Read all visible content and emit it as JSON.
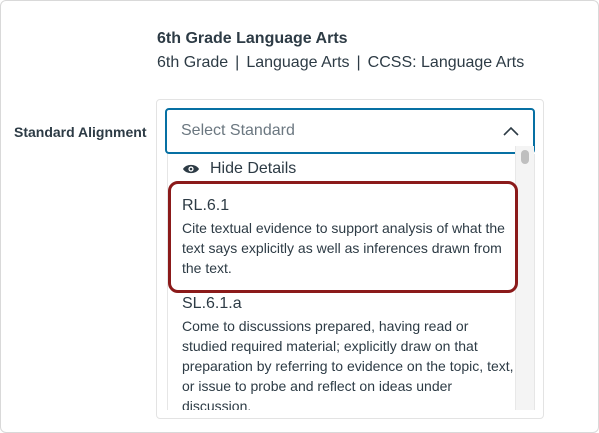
{
  "course": {
    "title": "6th Grade Language Arts",
    "grade": "6th Grade",
    "subject": "Language Arts",
    "standard_set": "CCSS: Language Arts",
    "separator": "|"
  },
  "field": {
    "label": "Standard Alignment",
    "placeholder": "Select Standard",
    "expanded": true
  },
  "dropdown": {
    "details_toggle_label": "Hide Details",
    "details_icon": "eye-icon",
    "options": [
      {
        "code": "RL.6.1",
        "description": "Cite textual evidence to support analysis of what the text says explicitly as well as inferences drawn from the text.",
        "highlighted": true
      },
      {
        "code": "SL.6.1.a",
        "description": "Come to discussions prepared, having read or studied required material; explicitly draw on that preparation by referring to evidence on the topic, text, or issue to probe and reflect on ideas under discussion.",
        "highlighted": false
      }
    ]
  },
  "colors": {
    "focus_border": "#0770a3",
    "highlight_border": "#8b1a1a",
    "text": "#2d3b45",
    "placeholder": "#6b7780"
  }
}
